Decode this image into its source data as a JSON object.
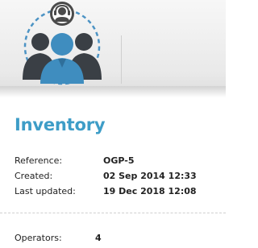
{
  "header": {
    "logo_icon": "operators-group-icon"
  },
  "main": {
    "title": "Inventory",
    "details": [
      {
        "label": "Reference:",
        "value": "OGP-5"
      },
      {
        "label": "Created:",
        "value": "02 Sep 2014 12:33"
      },
      {
        "label": "Last updated:",
        "value": "19 Dec 2018 12:08"
      }
    ],
    "operators": {
      "label": "Operators:",
      "value": "4"
    }
  },
  "colors": {
    "accent": "#3e9dc7",
    "icon_blue": "#3f8dbf",
    "icon_dark": "#4a4a4a"
  }
}
